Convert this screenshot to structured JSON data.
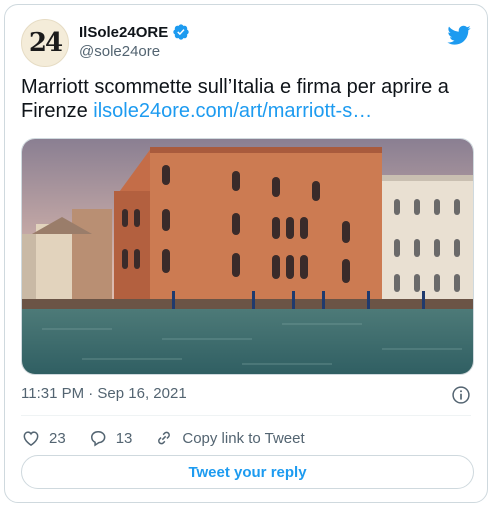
{
  "author": {
    "display_name": "IlSole24ORE",
    "handle": "@sole24ore",
    "avatar_text": "24",
    "verified": true
  },
  "tweet": {
    "text": "Marriott scommette sull’Italia e firma per aprire a Firenze ",
    "link_text": "ilsole24ore.com/art/marriott-s…",
    "media_icon": "photo-venice-palazzo",
    "timestamp": "11:31 PM · Sep 16, 2021"
  },
  "actions": {
    "like_count": "23",
    "reply_count": "13",
    "copy_link_label": "Copy link to Tweet"
  },
  "reply_button": "Tweet your reply",
  "colors": {
    "accent": "#1d9bf0",
    "muted": "#536471",
    "border": "#cfd9de"
  }
}
